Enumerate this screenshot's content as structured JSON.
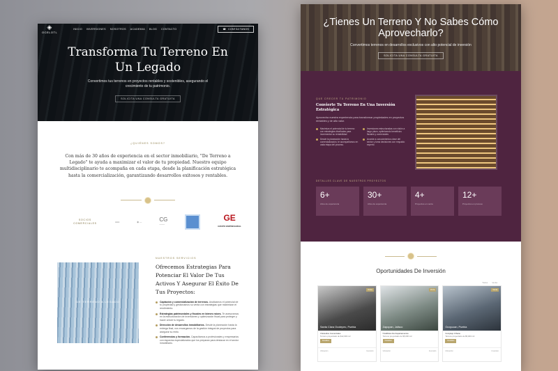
{
  "left": {
    "nav": {
      "logo_text": "OCELOTL",
      "links": [
        "INICIO",
        "INVERSIONES",
        "NOSOTROS",
        "ACADEMIA",
        "BLOG",
        "CONTACTO"
      ],
      "cta": "CONTÁCTANOS"
    },
    "hero": {
      "title": "Transforma Tu Terreno En Un Legado",
      "subtitle": "Convertimos tus terrenos en proyectos rentables y sostenibles, asegurando el crecimiento de tu patrimonio.",
      "button": "SOLICITA UNA CONSULTA GRATUITA"
    },
    "about": {
      "kicker": "¿QUIÉNES SOMOS?",
      "text": "Con más de 30 años de experiencia en el sector inmobiliario, \"De Terreno a Legado\" te ayuda a maximizar el valor de tu propiedad. Nuestro equipo multidisciplinario te acompaña en cada etapa, desde la planificación estratégica hasta la comercialización, garantizando desarrollos exitosos y rentables."
    },
    "partners": {
      "label": "SOCIOS COMERCIALES",
      "items": [
        "CG",
        "GE",
        "GRUPO EMPRESARIAL"
      ]
    },
    "services": {
      "photo_label": "DE TERRENO A LEGADO",
      "kicker": "NUESTROS SERVICIOS",
      "title": "Ofrecemos Estrategias Para Potenciar El Valor De Tus Activos Y Asegurar El Éxito De Tus Proyectos:",
      "items": [
        {
          "head": "Captación y comercialización de terrenos.",
          "body": "Analizamos el potencial de tu propiedad y gestionamos su venta con estrategias que maximizan el rendimiento."
        },
        {
          "head": "Estrategias patrimoniales y fiscales en bienes raíces.",
          "body": "Te asesoramos en la estructuración de inversiones y optimización fiscal para proteger y hacer crecer tu legado."
        },
        {
          "head": "Dirección de desarrollos inmobiliarios.",
          "body": "Desde la planeación hasta la entrega final, nos encargamos de la gestión integral de proyectos para asegurar su éxito."
        },
        {
          "head": "Conferencias y formación.",
          "body": "Capacitamos a profesionales y empresarios con espacios especializados que los preparan para destacar en el sector inmobiliario."
        }
      ]
    }
  },
  "right": {
    "hero": {
      "title": "¿Tienes Un Terreno Y No Sabes Cómo Aprovecharlo?",
      "subtitle": "Convertimos terrenos en desarrollos exclusivos con alto potencial de inversión",
      "button": "SOLICITA UNA CONSULTA GRATUITA"
    },
    "patrimonio": {
      "kicker": "QUE CRECER TU PATRIMONIO",
      "title": "Convierte Tu Terreno En Una Inversión Estratégica",
      "text": "Aprovecha nuestra experiencia para transformar propiedades en proyectos rentables y de alto valor.",
      "features": [
        "Maximiza el potencial de tu terreno con estrategias diseñadas para incrementar su rentabilidad",
        "Inversiones estructuradas con visión a largo plazo, optimizando beneficios fiscales y comerciales",
        "Desde la planeación hasta la comercialización, te acompañamos en cada etapa del proceso.",
        "Accede a conocimientos clave del sector y toma decisiones con respaldo experto"
      ]
    },
    "stats": {
      "title": "DETALLES CLAVE DE NUESTROS PROYECTOS",
      "items": [
        {
          "n": "6+",
          "d": "Años de experiencia"
        },
        {
          "n": "30+",
          "d": "Años de experiencia"
        },
        {
          "n": "4+",
          "d": "Proyectos en venta"
        },
        {
          "n": "12+",
          "d": "Proyectos en proceso"
        }
      ]
    },
    "opportunities": {
      "title": "Oportunidades De Inversión",
      "tabs": [
        "Todos",
        "Venta"
      ],
      "cards": [
        {
          "title": "Santa Clara Ocotepec, Puebla",
          "tag": "Venta",
          "type": "3 Estudios Comerciales",
          "price": "Terreno proyectado de $12,000 m2",
          "btn": "Detalles",
          "foot_l": "Ubicación",
          "foot_r": "Inversión"
        },
        {
          "title": "Zapopan, Jalisco",
          "tag": "Venta",
          "type": "5 Edificios De Departamentos",
          "price": "Terreno proyectado de $5,000 m2",
          "btn": "Detalles",
          "foot_l": "Ubicación",
          "foot_r": "Inversión"
        },
        {
          "title": "Ocoyucan, Puebla",
          "tag": "Venta",
          "type": "Complejo Urbano",
          "price": "Terreno proyectado de $5,000 m2",
          "btn": "Detalles",
          "foot_l": "Ubicación",
          "foot_r": "Inversión"
        }
      ]
    }
  }
}
